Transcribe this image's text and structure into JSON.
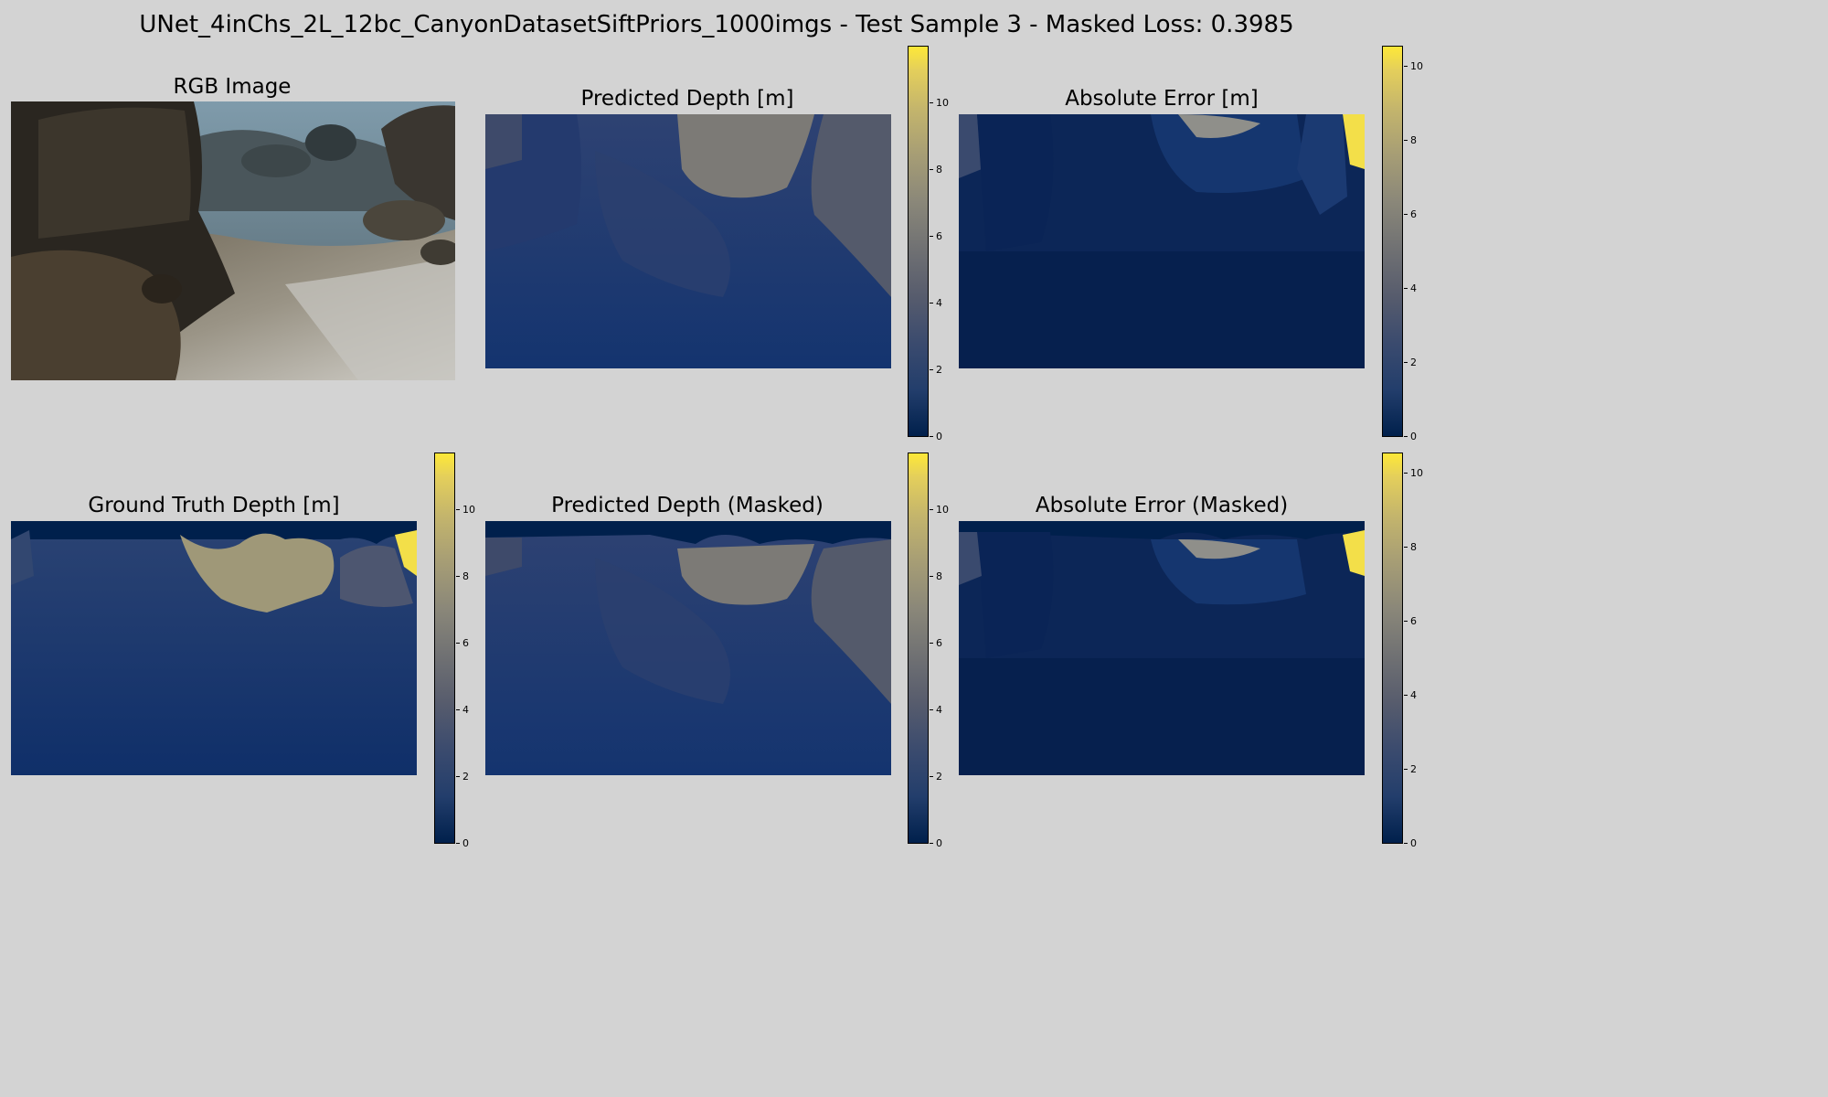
{
  "figure": {
    "suptitle": "UNet_4inChs_2L_12bc_CanyonDatasetSiftPriors_1000imgs - Test Sample 3 - Masked Loss: 0.3985",
    "colormap": "cividis",
    "background": "#d3d3d3"
  },
  "chart_data": [
    {
      "type": "image",
      "title": "RGB Image"
    },
    {
      "type": "heatmap",
      "title": "Predicted Depth [m]",
      "colorbar": {
        "min": 0,
        "max": 11.6,
        "ticks": [
          0,
          2,
          4,
          6,
          8,
          10
        ]
      }
    },
    {
      "type": "heatmap",
      "title": "Absolute Error [m]",
      "colorbar": {
        "min": 0,
        "max": 10.5,
        "ticks": [
          0,
          2,
          4,
          6,
          8,
          10
        ]
      }
    },
    {
      "type": "heatmap",
      "title": "Ground Truth Depth [m]",
      "colorbar": {
        "min": 0,
        "max": 11.6,
        "ticks": [
          0,
          2,
          4,
          6,
          8,
          10
        ]
      }
    },
    {
      "type": "heatmap",
      "title": "Predicted Depth (Masked)",
      "colorbar": {
        "min": 0,
        "max": 11.6,
        "ticks": [
          0,
          2,
          4,
          6,
          8,
          10
        ]
      }
    },
    {
      "type": "heatmap",
      "title": "Absolute Error (Masked)",
      "colorbar": {
        "min": 0,
        "max": 10.5,
        "ticks": [
          0,
          2,
          4,
          6,
          8,
          10
        ]
      }
    }
  ]
}
